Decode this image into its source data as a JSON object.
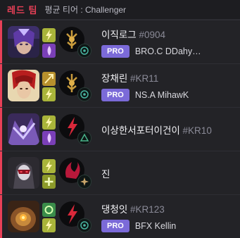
{
  "header": {
    "team_label": "레드 팀",
    "average_tier": "평균 티어 : Challenger"
  },
  "players": [
    {
      "name": "이직로그",
      "tag": "#0904",
      "pro_badge": "PRO",
      "pro_name": "BRO.C DDahy…",
      "champion_icon": "champion-portrait-icon",
      "spell1_icon": "flash-spell-icon",
      "spell2_icon": "ignite-spell-icon",
      "keystone_icon": "precision-keystone-icon",
      "secondary_icon": "secondary-tree-icon"
    },
    {
      "name": "장채린",
      "tag": "#KR11",
      "pro_badge": "PRO",
      "pro_name": "NS.A MihawK",
      "champion_icon": "champion-portrait-icon",
      "spell1_icon": "smite-spell-icon",
      "spell2_icon": "flash-spell-icon",
      "keystone_icon": "precision-keystone-icon",
      "secondary_icon": "secondary-tree-icon"
    },
    {
      "name": "이상한서포터이건이",
      "tag": "#KR10",
      "pro_badge": "",
      "pro_name": "",
      "champion_icon": "champion-portrait-icon",
      "spell1_icon": "flash-spell-icon",
      "spell2_icon": "ignite-spell-icon",
      "keystone_icon": "domination-keystone-icon",
      "secondary_icon": "secondary-tree-icon"
    },
    {
      "name": "진",
      "tag": "",
      "pro_badge": "",
      "pro_name": "",
      "champion_icon": "champion-portrait-icon",
      "spell1_icon": "flash-spell-icon",
      "spell2_icon": "heal-spell-icon",
      "keystone_icon": "domination-keystone-icon",
      "secondary_icon": "secondary-tree-icon"
    },
    {
      "name": "댕청잇",
      "tag": "#KR123",
      "pro_badge": "PRO",
      "pro_name": "BFX Kellin",
      "champion_icon": "champion-portrait-icon",
      "spell1_icon": "barrier-spell-icon",
      "spell2_icon": "flash-spell-icon",
      "keystone_icon": "domination-keystone-icon",
      "secondary_icon": "secondary-tree-icon"
    }
  ],
  "colors": {
    "team_red": "#e84057",
    "pro_badge": "#7b6ad8",
    "tag_gray": "#8a8a97"
  }
}
